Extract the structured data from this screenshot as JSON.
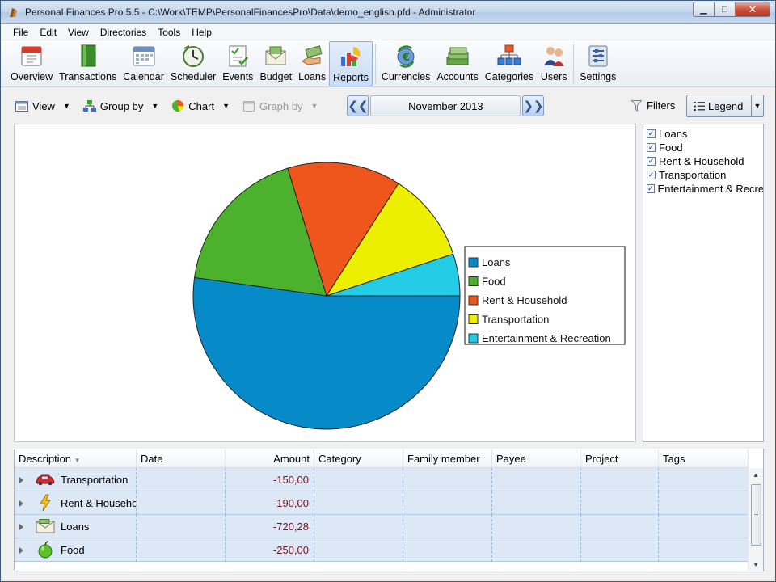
{
  "window": {
    "title": "Personal Finances Pro 5.5 - C:\\Work\\TEMP\\PersonalFinancesPro\\Data\\demo_english.pfd - Administrator",
    "min_glyph": "▁",
    "max_glyph": "□",
    "close_glyph": "✕"
  },
  "menu": [
    "File",
    "Edit",
    "View",
    "Directories",
    "Tools",
    "Help"
  ],
  "toolbar": [
    {
      "label": "Overview",
      "icon": "calendar-day-icon"
    },
    {
      "label": "Transactions",
      "icon": "book-icon"
    },
    {
      "label": "Calendar",
      "icon": "calendar-icon"
    },
    {
      "label": "Scheduler",
      "icon": "clock-icon"
    },
    {
      "label": "Events",
      "icon": "checklist-icon"
    },
    {
      "label": "Budget",
      "icon": "envelope-money-icon"
    },
    {
      "label": "Loans",
      "icon": "hand-money-icon"
    },
    {
      "label": "Reports",
      "icon": "pie-chart-icon",
      "active": true
    },
    {
      "label": "Currencies",
      "icon": "currency-exchange-icon"
    },
    {
      "label": "Accounts",
      "icon": "money-stack-icon"
    },
    {
      "label": "Categories",
      "icon": "hierarchy-icon"
    },
    {
      "label": "Users",
      "icon": "users-icon"
    },
    {
      "label": "Settings",
      "icon": "settings-icon"
    }
  ],
  "subbar": {
    "view": "View",
    "group_by": "Group by",
    "chart": "Chart",
    "graph_by": "Graph by",
    "period": "November 2013",
    "prev": "❮❮",
    "next": "❯❯",
    "filters": "Filters",
    "legend": "Legend"
  },
  "legend_panel": [
    "Loans",
    "Food",
    "Rent & Household",
    "Transportation",
    "Entertainment & Recreation"
  ],
  "chart_data": {
    "type": "pie",
    "categories": [
      "Loans",
      "Food",
      "Rent & Household",
      "Transportation",
      "Entertainment & Recreation"
    ],
    "values": [
      720.28,
      250.0,
      190.0,
      150.0,
      70.0
    ],
    "colors": [
      "#068bc8",
      "#4cb22e",
      "#ef561b",
      "#ecef00",
      "#23cce4"
    ],
    "legend": [
      "Loans",
      "Food",
      "Rent & Household",
      "Transportation",
      "Entertainment & Recreation"
    ],
    "legend_position": "right"
  },
  "grid": {
    "columns": [
      "Description",
      "Date",
      "Amount",
      "Category",
      "Family member",
      "Payee",
      "Project",
      "Tags"
    ],
    "rows": [
      {
        "description": "Transportation",
        "amount": "-150,00",
        "icon": "car-icon"
      },
      {
        "description": "Rent & Household",
        "amount": "-190,00",
        "icon": "lightning-icon"
      },
      {
        "description": "Loans",
        "amount": "-720,28",
        "icon": "envelope-icon"
      },
      {
        "description": "Food",
        "amount": "-250,00",
        "icon": "apple-icon"
      }
    ]
  }
}
